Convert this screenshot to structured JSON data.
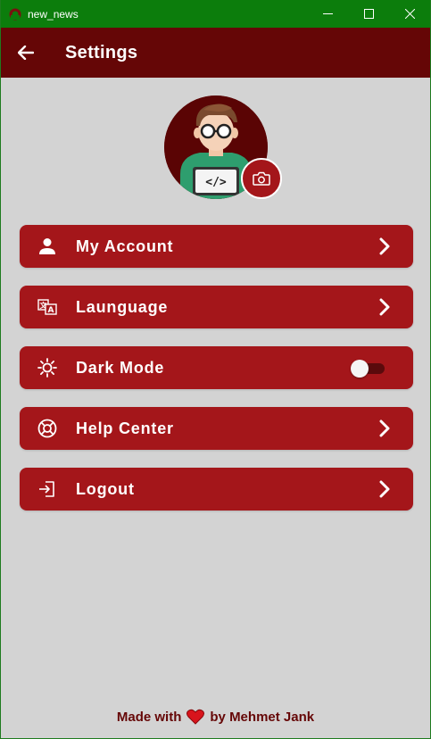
{
  "window": {
    "title": "new_news"
  },
  "appbar": {
    "title": "Settings"
  },
  "menu": {
    "items": [
      {
        "label": "My Account",
        "icon": "person-icon"
      },
      {
        "label": "Launguage",
        "icon": "translate-icon"
      },
      {
        "label": "Dark Mode",
        "icon": "sun-icon",
        "toggle": false
      },
      {
        "label": "Help Center",
        "icon": "lifebuoy-icon"
      },
      {
        "label": "Logout",
        "icon": "logout-icon"
      }
    ]
  },
  "footer": {
    "prefix": "Made with",
    "suffix": "by Mehmet Jank"
  },
  "colors": {
    "titlebar": "#0c7d0c",
    "appbar": "#650606",
    "accent": "#a4161a",
    "background": "#d3d3d3"
  }
}
